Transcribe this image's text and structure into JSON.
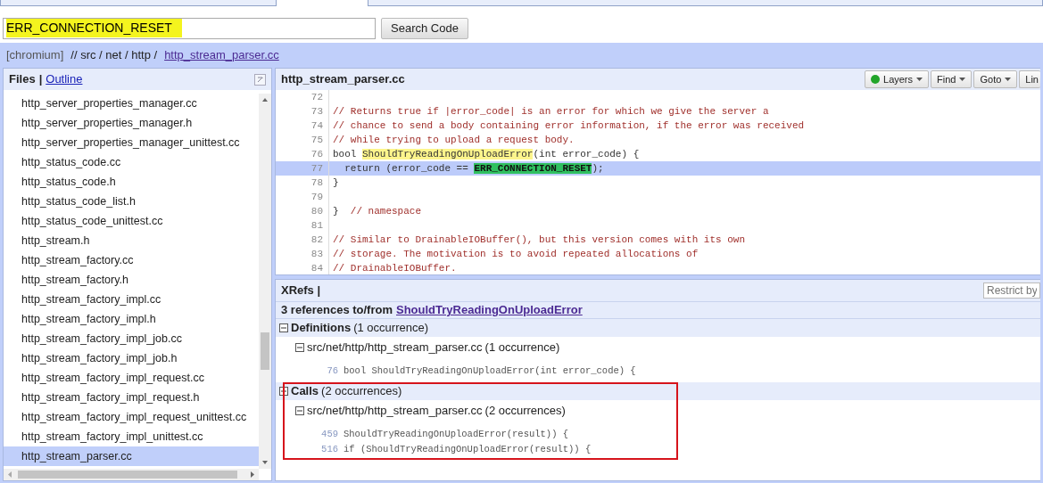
{
  "search": {
    "value": "ERR_CONNECTION_RESET",
    "button": "Search Code"
  },
  "breadcrumb": {
    "project": "[chromium]",
    "path": "// src / net / http /",
    "file": "http_stream_parser.cc"
  },
  "files": {
    "separator": "|",
    "tabs": [
      {
        "label": "Files",
        "selected": true
      },
      {
        "label": "Outline",
        "selected": false
      }
    ],
    "items": [
      {
        "name": "http_server_properties_manager.cc",
        "selected": false
      },
      {
        "name": "http_server_properties_manager.h",
        "selected": false
      },
      {
        "name": "http_server_properties_manager_unittest.cc",
        "selected": false
      },
      {
        "name": "http_status_code.cc",
        "selected": false
      },
      {
        "name": "http_status_code.h",
        "selected": false
      },
      {
        "name": "http_status_code_list.h",
        "selected": false
      },
      {
        "name": "http_status_code_unittest.cc",
        "selected": false
      },
      {
        "name": "http_stream.h",
        "selected": false
      },
      {
        "name": "http_stream_factory.cc",
        "selected": false
      },
      {
        "name": "http_stream_factory.h",
        "selected": false
      },
      {
        "name": "http_stream_factory_impl.cc",
        "selected": false
      },
      {
        "name": "http_stream_factory_impl.h",
        "selected": false
      },
      {
        "name": "http_stream_factory_impl_job.cc",
        "selected": false
      },
      {
        "name": "http_stream_factory_impl_job.h",
        "selected": false
      },
      {
        "name": "http_stream_factory_impl_request.cc",
        "selected": false
      },
      {
        "name": "http_stream_factory_impl_request.h",
        "selected": false
      },
      {
        "name": "http_stream_factory_impl_request_unittest.cc",
        "selected": false
      },
      {
        "name": "http_stream_factory_impl_unittest.cc",
        "selected": false
      },
      {
        "name": "http_stream_parser.cc",
        "selected": true
      }
    ]
  },
  "editor": {
    "title": "http_stream_parser.cc",
    "toolbar": [
      {
        "label": "Layers",
        "kind": "status"
      },
      {
        "label": "Find",
        "kind": "menu"
      },
      {
        "label": "Goto",
        "kind": "menu"
      },
      {
        "label": "Lin",
        "kind": "plain"
      }
    ],
    "lines": [
      {
        "number": "72",
        "current": false
      },
      {
        "number": "73",
        "current": false,
        "segments": [
          {
            "text": "// Returns true if |error_code| is an error for which we give the server a",
            "kind": "comment"
          }
        ]
      },
      {
        "number": "74",
        "current": false,
        "segments": [
          {
            "text": "// chance to send a body containing error information, if the error was received",
            "kind": "comment"
          }
        ]
      },
      {
        "number": "75",
        "current": false,
        "segments": [
          {
            "text": "// while trying to upload a request body.",
            "kind": "comment"
          }
        ]
      },
      {
        "number": "76",
        "current": false,
        "segments": [
          {
            "text": "bool ",
            "kind": "code"
          },
          {
            "text": "ShouldTryReadingOnUploadError",
            "kind": "symbol"
          },
          {
            "text": "(int error_code) {",
            "kind": "code"
          }
        ]
      },
      {
        "number": "77",
        "current": true,
        "segments": [
          {
            "text": "  return (error_code == ",
            "kind": "code"
          },
          {
            "text": "ERR_CONNECTION_RESET",
            "kind": "match"
          },
          {
            "text": ");",
            "kind": "code"
          }
        ]
      },
      {
        "number": "78",
        "current": false,
        "segments": [
          {
            "text": "}",
            "kind": "code"
          }
        ]
      },
      {
        "number": "79",
        "current": false
      },
      {
        "number": "80",
        "current": false,
        "segments": [
          {
            "text": "}  ",
            "kind": "code"
          },
          {
            "text": "// namespace",
            "kind": "comment"
          }
        ]
      },
      {
        "number": "81",
        "current": false
      },
      {
        "number": "82",
        "current": false,
        "segments": [
          {
            "text": "// Similar to DrainableIOBuffer(), but this version comes with its own",
            "kind": "comment"
          }
        ]
      },
      {
        "number": "83",
        "current": false,
        "segments": [
          {
            "text": "// storage. The motivation is to avoid repeated allocations of",
            "kind": "comment"
          }
        ]
      },
      {
        "number": "84",
        "current": false,
        "segments": [
          {
            "text": "// DrainableIOBuffer.",
            "kind": "comment"
          }
        ]
      }
    ]
  },
  "xrefs": {
    "title": "XRefs |",
    "restrict_placeholder": "Restrict by",
    "summary": "3 references to/from",
    "symbol": "ShouldTryReadingOnUploadError",
    "groups": [
      {
        "label": "Definitions",
        "count": "(1 occurrence)",
        "expanded": true,
        "outlined": false,
        "files": [
          {
            "path": "src/net/http/http_stream_parser.cc",
            "count": "(1 occurrence)",
            "expanded": true,
            "lines": [
              {
                "number": "76",
                "code": "bool ShouldTryReadingOnUploadError(int error_code) {"
              }
            ]
          }
        ]
      },
      {
        "label": "Calls",
        "count": "(2 occurrences)",
        "expanded": true,
        "outlined": true,
        "files": [
          {
            "path": "src/net/http/http_stream_parser.cc",
            "count": "(2 occurrences)",
            "expanded": true,
            "lines": [
              {
                "number": "459",
                "code": "ShouldTryReadingOnUploadError(result)) {"
              },
              {
                "number": "516",
                "code": "if (ShouldTryReadingOnUploadError(result)) {"
              }
            ]
          }
        ]
      }
    ]
  }
}
